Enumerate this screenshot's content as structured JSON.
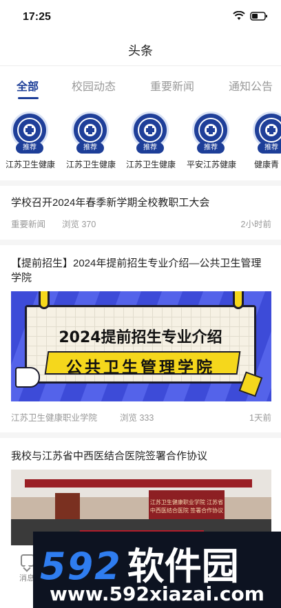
{
  "status_bar": {
    "time": "17:25"
  },
  "header": {
    "title": "头条"
  },
  "tabs": [
    {
      "label": "全部",
      "active": true
    },
    {
      "label": "校园动态",
      "active": false
    },
    {
      "label": "重要新闻",
      "active": false
    },
    {
      "label": "通知公告",
      "active": false
    }
  ],
  "channels": [
    {
      "badge": "推荐",
      "name": "江苏卫生健康"
    },
    {
      "badge": "推荐",
      "name": "江苏卫生健康"
    },
    {
      "badge": "推荐",
      "name": "江苏卫生健康"
    },
    {
      "badge": "推荐",
      "name": "平安江苏健康"
    },
    {
      "badge": "推荐",
      "name": "健康青"
    }
  ],
  "news": [
    {
      "title": "学校召开2024年春季新学期全校教职工大会",
      "source": "重要新闻",
      "views": "浏览 370",
      "time": "2小时前"
    },
    {
      "title": "【提前招生】2024年提前招生专业介绍—公共卫生管理学院",
      "image_line1": "2024提前招生专业介绍",
      "image_line2": "公共卫生管理学院",
      "source": "江苏卫生健康职业学院",
      "views": "浏览 333",
      "time": "1天前"
    },
    {
      "title": "我校与江苏省中西医结合医院签署合作协议",
      "image_text": "江苏卫生健康职业学院 江苏省中西医结合医院 签署合作协议"
    }
  ],
  "bottom_tab": {
    "message_label": "消息"
  },
  "watermark": {
    "line1": "592",
    "line1_zh": "软件园",
    "line2": "www.592xiazai.com"
  },
  "colors": {
    "accent": "#1d3e98",
    "muted": "#999999"
  }
}
